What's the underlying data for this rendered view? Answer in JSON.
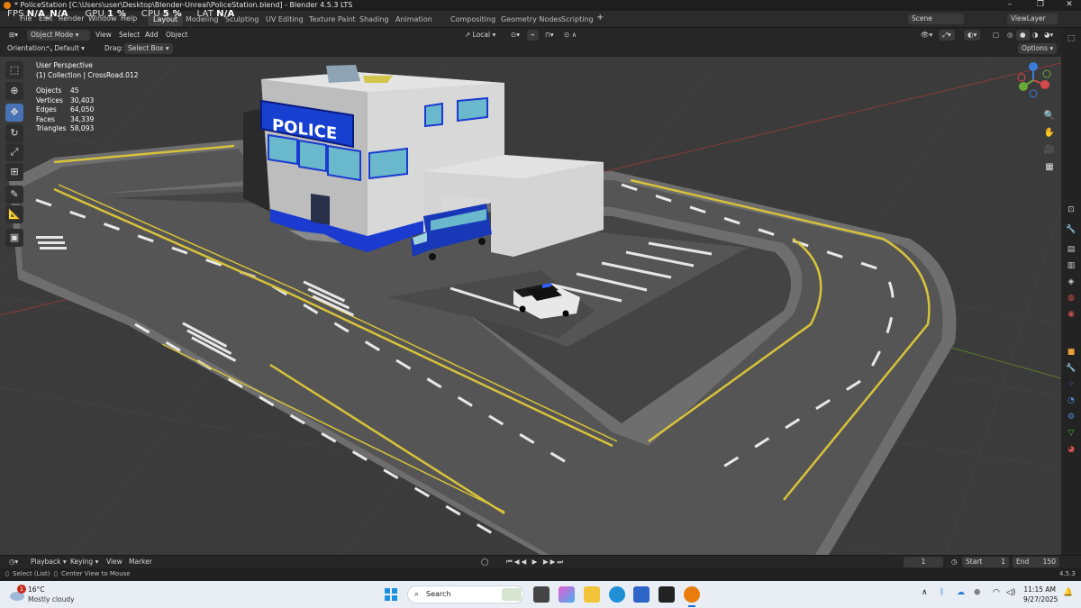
{
  "window": {
    "title": "* PoliceStation [C:\\Users\\user\\Desktop\\Blender-Unreal\\PoliceStation.blend] - Blender 4.5.3 LTS"
  },
  "overlay_fps": {
    "fps_label": "FPS",
    "fps_value": "N/A_N/A",
    "gpu_label": "GPU",
    "gpu_value": "1 %",
    "cpu_label": "CPU",
    "cpu_value": "5 %",
    "lat_label": "LAT",
    "lat_value": "N/A"
  },
  "menu": {
    "file": "File",
    "edit": "Edit",
    "render": "Render",
    "window": "Window",
    "help": "Help"
  },
  "workspaces": [
    "Layout",
    "Modeling",
    "Sculpting",
    "UV Editing",
    "Texture Paint",
    "Shading",
    "Animation",
    "Compositing",
    "Geometry Nodes",
    "Scripting"
  ],
  "scene": {
    "name": "Scene",
    "view_layer": "ViewLayer"
  },
  "header": {
    "mode": "Object Mode",
    "view": "View",
    "select": "Select",
    "add": "Add",
    "object": "Object",
    "transform_space": "Local"
  },
  "tool_settings": {
    "orientation_label": "Orientation:",
    "orientation_value": "Default",
    "drag_label": "Drag:",
    "drag_value": "Select Box",
    "options": "Options"
  },
  "viewport_info": {
    "view_name": "User Perspective",
    "collection": "(1) Collection | CrossRoad.012",
    "stats": [
      {
        "k": "Objects",
        "v": "45"
      },
      {
        "k": "Vertices",
        "v": "30,403"
      },
      {
        "k": "Edges",
        "v": "64,050"
      },
      {
        "k": "Faces",
        "v": "34,339"
      },
      {
        "k": "Triangles",
        "v": "58,093"
      }
    ]
  },
  "scene_content": {
    "building_sign": "POLICE"
  },
  "timeline": {
    "playback": "Playback",
    "keying": "Keying",
    "view": "View",
    "marker": "Marker",
    "current_frame": "1",
    "start_label": "Start",
    "start_value": "1",
    "end_label": "End",
    "end_value": "150"
  },
  "statusbar": {
    "hint1": "Select (List)",
    "hint2": "Center View to Mouse",
    "version": "4.5.3"
  },
  "taskbar": {
    "temperature": "16°C",
    "weather": "Mostly cloudy",
    "search_placeholder": "Search",
    "time": "11:15 AM",
    "date": "9/27/2025",
    "badge": "1"
  },
  "colors": {
    "accent": "#4772b3",
    "blender_orange": "#e87d0d"
  }
}
